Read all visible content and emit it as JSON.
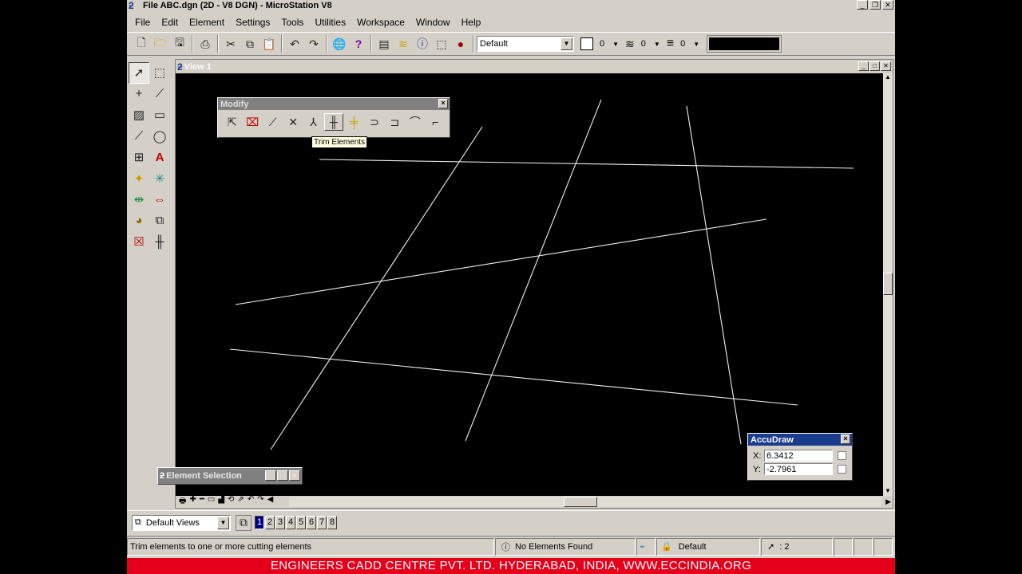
{
  "window": {
    "title": "File ABC.dgn (2D - V8 DGN) - MicroStation V8"
  },
  "menu": [
    "File",
    "Edit",
    "Element",
    "Settings",
    "Tools",
    "Utilities",
    "Workspace",
    "Window",
    "Help"
  ],
  "toolbar": {
    "level_value": "Default",
    "color_value": "0",
    "style_value": "0",
    "weight_value": "0"
  },
  "view": {
    "title": "View 1"
  },
  "modify_dialog": {
    "title": "Modify",
    "tooltip": "Trim Elements"
  },
  "accudraw": {
    "title": "AccuDraw",
    "x_label": "X:",
    "x_value": "6.3412",
    "y_label": "Y:",
    "y_value": "-2.7961"
  },
  "element_selection": {
    "title": "Element Selection"
  },
  "views_bar": {
    "saved_views": "Default Views",
    "view_numbers": [
      "1",
      "2",
      "3",
      "4",
      "5",
      "6",
      "7",
      "8"
    ]
  },
  "status": {
    "prompt": "Trim elements to one or more cutting elements",
    "message": "No Elements Found",
    "level": "Default",
    "selection_count": ": 2"
  },
  "footer": {
    "text": "ENGINEERS CADD CENTRE PVT. LTD. HYDERABAD, INDIA, WWW.ECCINDIA.ORG"
  },
  "colors": {
    "footer_bg": "#e4001b",
    "view_bg": "#000000",
    "line": "#f0f0f0",
    "window_gray": "#d4d0c8"
  },
  "icons": {
    "standard": [
      "new-file-icon",
      "open-file-icon",
      "save-icon",
      "print-icon",
      "cut-icon",
      "copy-icon",
      "paste-icon",
      "undo-icon",
      "redo-icon",
      "globe-icon",
      "help-icon"
    ],
    "main_tools": [
      "select-arrow-icon",
      "fence-icon",
      "point-icon",
      "measure-icon",
      "hatch-icon",
      "rectangle-icon",
      "line-icon",
      "circle-icon",
      "cell-icon",
      "text-icon",
      "dimension-icon",
      "snap-icon",
      "copy-element-icon",
      "move-element-icon",
      "palette-icon",
      "group-icon",
      "delete-icon",
      "trim-icon"
    ],
    "modify": [
      "modify-element-icon",
      "delete-part-icon",
      "extend-line-icon",
      "extend-2-elements-icon",
      "extend-to-intersection-icon",
      "trim-elements-icon",
      "intellitrim-icon",
      "insert-vertex-icon",
      "delete-vertex-icon",
      "fillet-icon",
      "chamfer-icon"
    ]
  }
}
